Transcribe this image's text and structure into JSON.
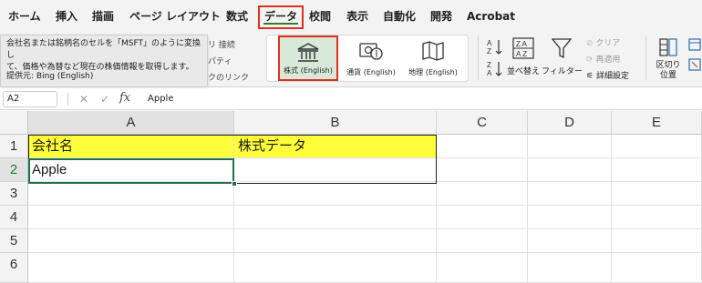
{
  "tabs": [
    "ホーム",
    "挿入",
    "描画",
    "ページ レイアウト",
    "数式",
    "データ",
    "校閲",
    "表示",
    "自動化",
    "開発",
    "Acrobat"
  ],
  "active_tab": "データ",
  "tooltip": {
    "text_line1": "会社名または銘柄名のセルを「MSFT」のように変換し",
    "text_line2": "て、価格や為替など現在の株価情報を取得します。",
    "source": "提供元: Bing (English)"
  },
  "ribbon_background": {
    "connections": "リ 接続",
    "properties": "パティ",
    "links": "クのリンク"
  },
  "data_types": [
    {
      "label": "株式 (English)",
      "icon": "bank-icon",
      "selected": true
    },
    {
      "label": "通貨 (English)",
      "icon": "currency-icon",
      "selected": false
    },
    {
      "label": "地理 (English)",
      "icon": "map-icon",
      "selected": false
    }
  ],
  "sort_filter": {
    "sort_asc_label": "A→Z",
    "sort_desc_label": "Z→A",
    "sort_label": "並べ替え",
    "filter_label": "フィルター",
    "clear_label": "クリア",
    "reapply_label": "再適用",
    "advanced_label": "詳細設定"
  },
  "data_tools": {
    "text_to_columns_line1": "区切り",
    "text_to_columns_line2": "位置"
  },
  "formula_bar": {
    "name_box": "A2",
    "cancel_icon": "✕",
    "confirm_icon": "✓",
    "fx": "fx",
    "value": "Apple"
  },
  "grid": {
    "columns": [
      "A",
      "B",
      "C",
      "D",
      "E"
    ],
    "rows": [
      "1",
      "2",
      "3",
      "4",
      "5",
      "6"
    ],
    "cells": {
      "A1": "会社名",
      "B1": "株式データ",
      "A2": "Apple",
      "B2": ""
    },
    "selected_cell": "A2",
    "colors": {
      "header_fill": "#fffe38",
      "selection": "#217346",
      "active_tab_border": "#e0301e"
    }
  }
}
